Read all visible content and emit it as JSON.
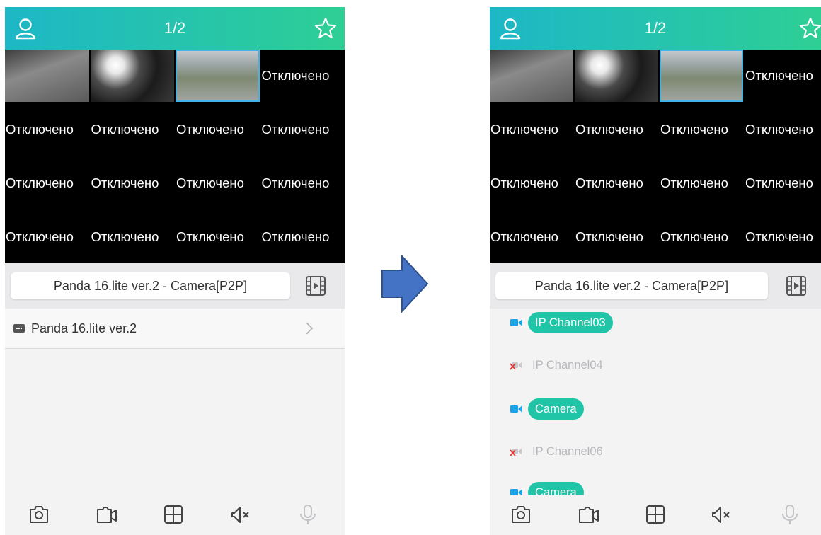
{
  "colors": {
    "header_gradient_start": "#1db7c7",
    "header_gradient_end": "#2ecf95",
    "channel_pill": "#20c5a8",
    "arrow": "#4472c4"
  },
  "left_screen": {
    "header": {
      "title": "1/2",
      "left_icon": "user-icon",
      "right_icon": "star-icon"
    },
    "grid": {
      "row1": {
        "c4": "Отключено"
      },
      "row2": [
        "Отключено",
        "Отключено",
        "Отключено",
        "Отключено"
      ],
      "row3": [
        "Отключено",
        "Отключено",
        "Отключено",
        "Отключено"
      ],
      "row4": [
        "Отключено",
        "Отключено",
        "Отключено",
        "Отключено"
      ]
    },
    "device_selector": "Panda 16.lite ver.2 - Camera[P2P]",
    "device_list": [
      {
        "label": "Panda 16.lite ver.2"
      }
    ],
    "toolbar": [
      "camera-snapshot-icon",
      "record-icon",
      "grid-layout-icon",
      "mute-icon",
      "microphone-icon"
    ]
  },
  "right_screen": {
    "header": {
      "title": "1/2",
      "left_icon": "user-icon",
      "right_icon": "star-icon"
    },
    "grid": {
      "row1": {
        "c4": "Отключено"
      },
      "row2": [
        "Отключено",
        "Отключено",
        "Отключено",
        "Отключено"
      ],
      "row3": [
        "Отключено",
        "Отключено",
        "Отключено",
        "Отключено"
      ],
      "row4": [
        "Отключено",
        "Отключено",
        "Отключено",
        "Отключено"
      ]
    },
    "device_selector": "Panda 16.lite ver.2 - Camera[P2P]",
    "channels": [
      {
        "label": "IP Channel03",
        "online": true
      },
      {
        "label": "IP Channel04",
        "online": false
      },
      {
        "label": "Camera",
        "online": true
      },
      {
        "label": "IP Channel06",
        "online": false
      },
      {
        "label": "Camera",
        "online": true
      }
    ],
    "toolbar": [
      "camera-snapshot-icon",
      "record-icon",
      "grid-layout-icon",
      "mute-icon",
      "microphone-icon"
    ]
  }
}
